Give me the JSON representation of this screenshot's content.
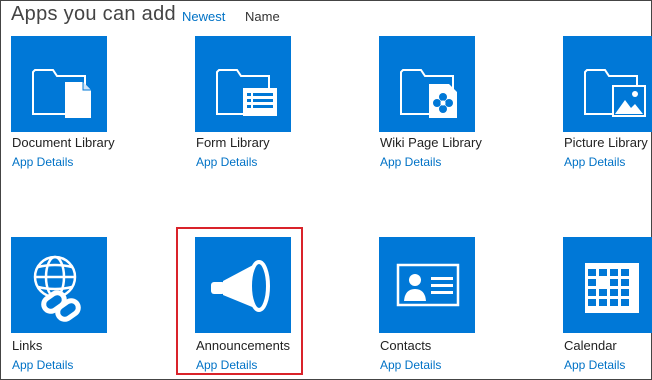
{
  "header": {
    "title": "Apps you can add",
    "sort_newest": "Newest",
    "sort_name": "Name"
  },
  "apps": [
    {
      "title": "Document Library",
      "details": "App Details",
      "icon": "document-library-icon"
    },
    {
      "title": "Form Library",
      "details": "App Details",
      "icon": "form-library-icon"
    },
    {
      "title": "Wiki Page Library",
      "details": "App Details",
      "icon": "wiki-page-library-icon"
    },
    {
      "title": "Picture Library",
      "details": "App Details",
      "icon": "picture-library-icon"
    },
    {
      "title": "Links",
      "details": "App Details",
      "icon": "links-icon"
    },
    {
      "title": "Announcements",
      "details": "App Details",
      "icon": "megaphone-icon"
    },
    {
      "title": "Contacts",
      "details": "App Details",
      "icon": "contact-card-icon"
    },
    {
      "title": "Calendar",
      "details": "App Details",
      "icon": "calendar-icon"
    }
  ],
  "colors": {
    "tile": "#0078d7",
    "link": "#0072c6",
    "highlight": "#d9232a"
  }
}
